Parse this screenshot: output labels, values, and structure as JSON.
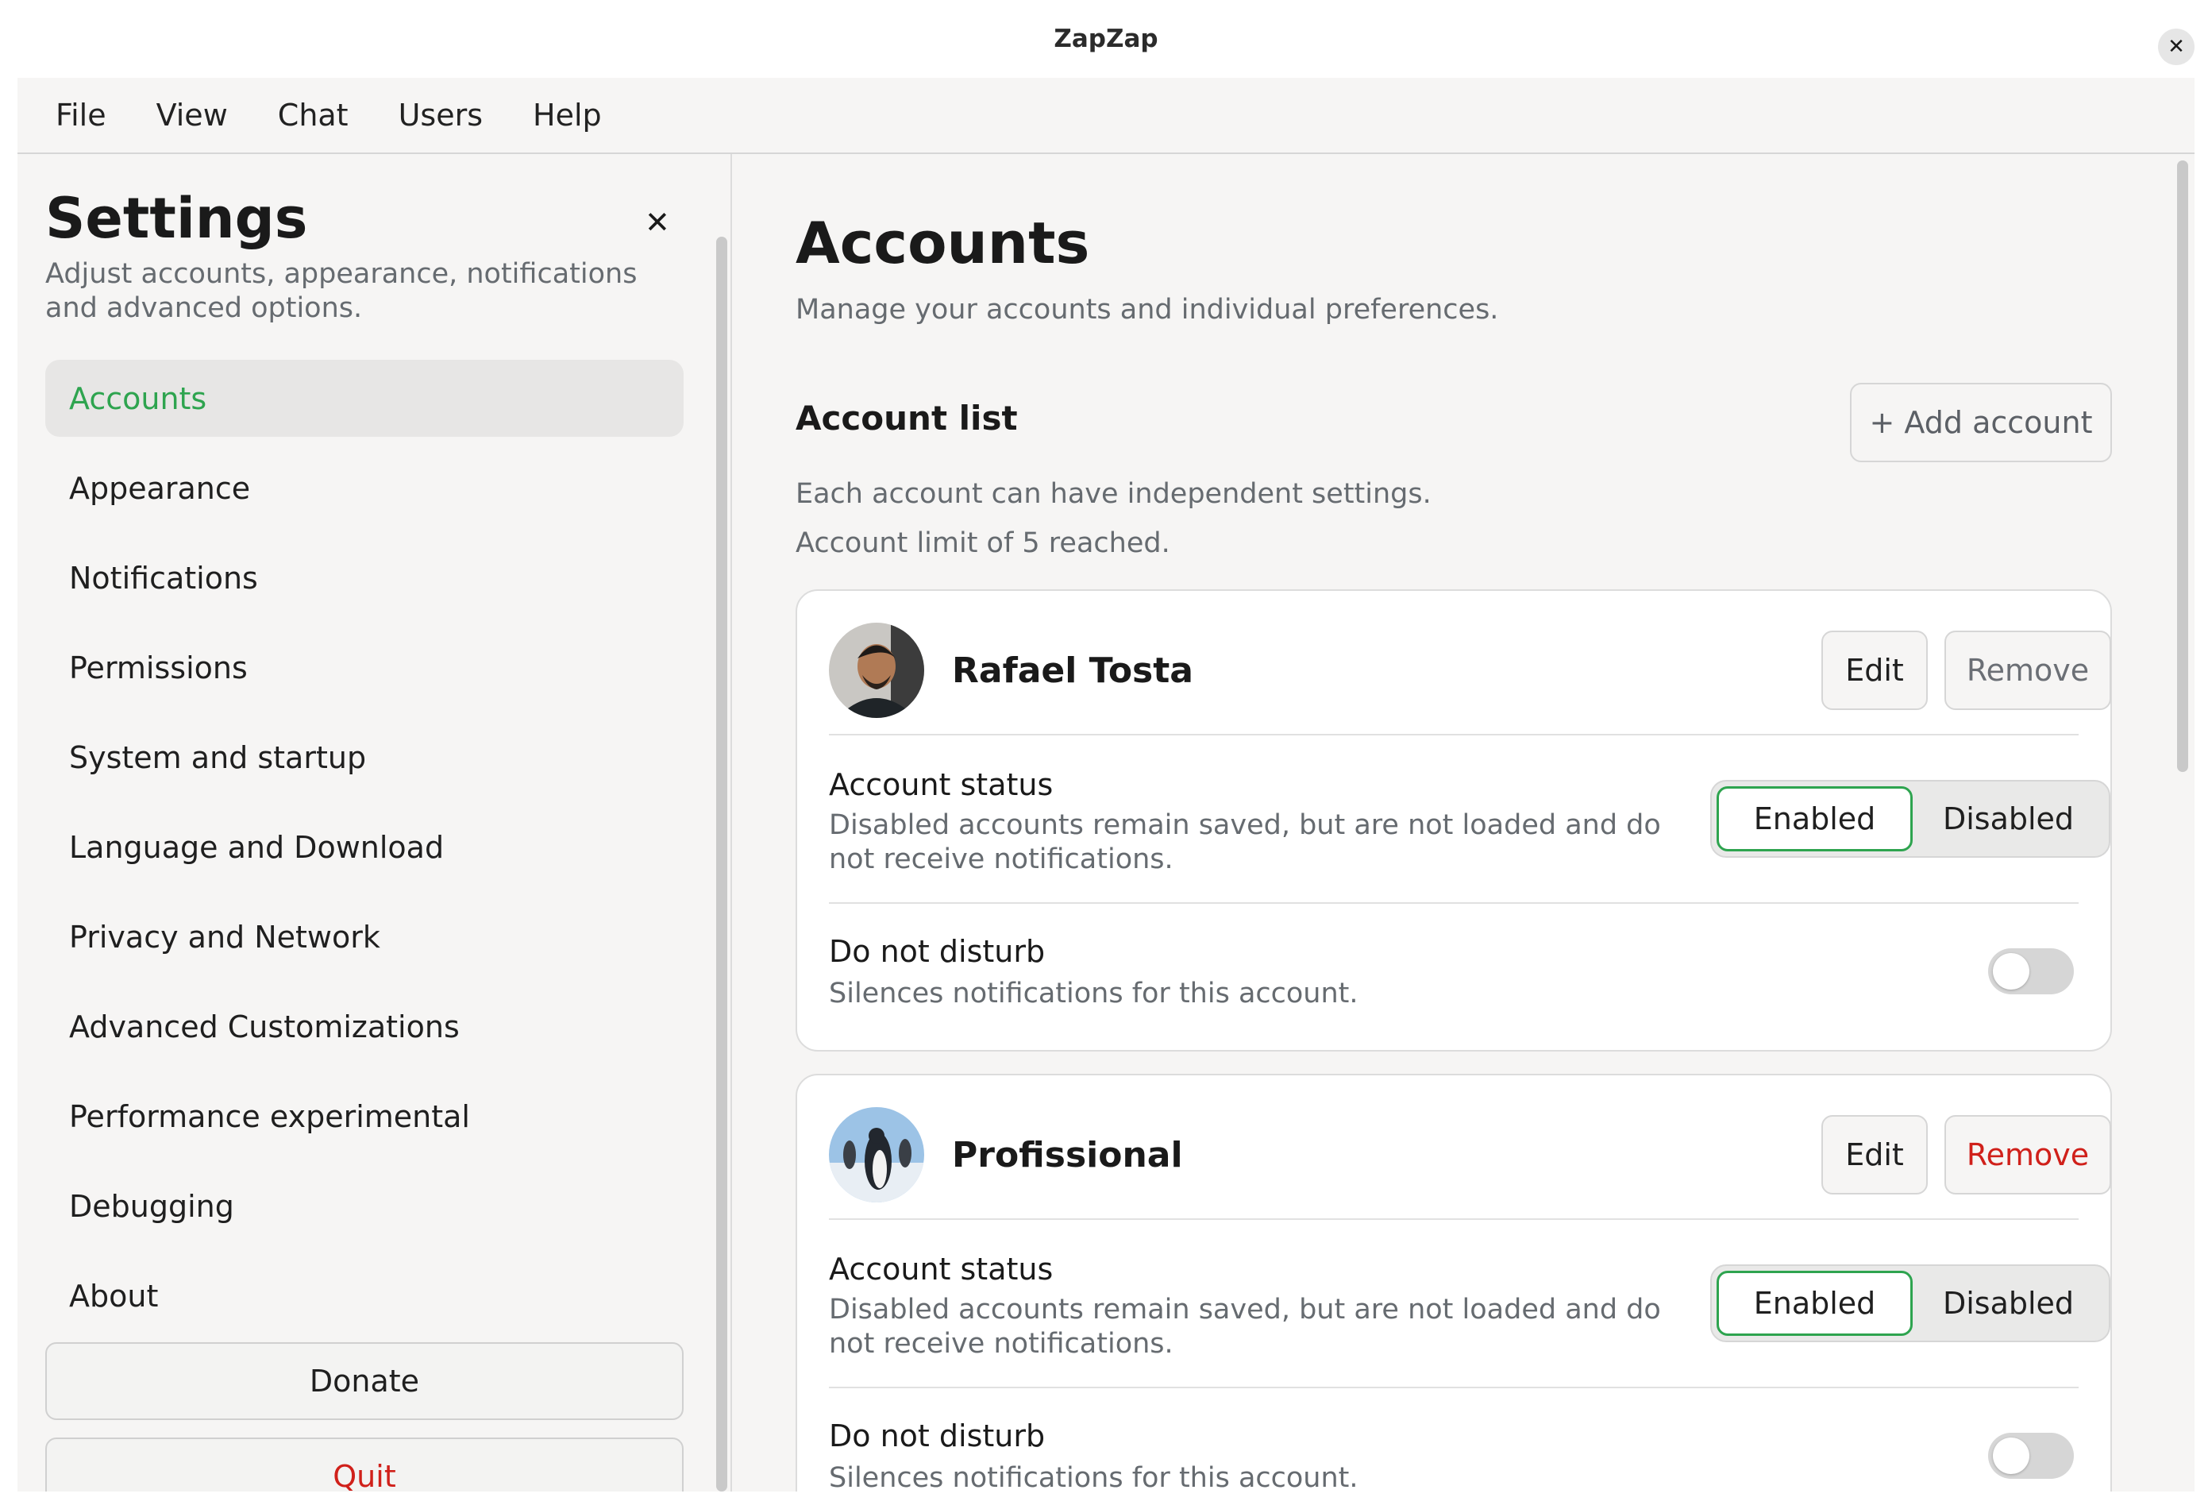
{
  "window": {
    "title": "ZapZap"
  },
  "menubar": [
    "File",
    "View",
    "Chat",
    "Users",
    "Help"
  ],
  "sidebar": {
    "title": "Settings",
    "subtitle": "Adjust accounts, appearance, notifications and advanced options.",
    "items": [
      {
        "label": "Accounts",
        "active": true
      },
      {
        "label": "Appearance"
      },
      {
        "label": "Notifications"
      },
      {
        "label": "Permissions"
      },
      {
        "label": "System and startup"
      },
      {
        "label": "Language and Download"
      },
      {
        "label": "Privacy and Network"
      },
      {
        "label": "Advanced Customizations"
      },
      {
        "label": "Performance experimental"
      },
      {
        "label": "Debugging"
      },
      {
        "label": "About"
      }
    ],
    "donate_label": "Donate",
    "quit_label": "Quit"
  },
  "main": {
    "title": "Accounts",
    "subtitle": "Manage your accounts and individual preferences.",
    "section_title": "Account list",
    "add_button": "+ Add account",
    "description": "Each account can have independent settings.",
    "limit_text": "Account limit of 5 reached."
  },
  "accounts": [
    {
      "name": "Rafael Tosta",
      "avatar_icon": "person-photo-icon",
      "edit_label": "Edit",
      "remove_label": "Remove",
      "remove_color": "#6b6f75",
      "status_label": "Account status",
      "status_desc": "Disabled accounts remain saved, but are not loaded and do not receive notifications.",
      "enabled_label": "Enabled",
      "disabled_label": "Disabled",
      "status_selected": "Enabled",
      "dnd_label": "Do not disturb",
      "dnd_desc": "Silences notifications for this account.",
      "dnd_on": false
    },
    {
      "name": "Profissional",
      "avatar_icon": "penguin-photo-icon",
      "edit_label": "Edit",
      "remove_label": "Remove",
      "remove_color": "#d0201a",
      "status_label": "Account status",
      "status_desc": "Disabled accounts remain saved, but are not loaded and do not receive notifications.",
      "enabled_label": "Enabled",
      "disabled_label": "Disabled",
      "status_selected": "Enabled",
      "dnd_label": "Do not disturb",
      "dnd_desc": "Silences notifications for this account.",
      "dnd_on": false
    }
  ],
  "colors": {
    "accent": "#2ea44f",
    "danger": "#d0201a",
    "muted_text": "#666b70"
  }
}
